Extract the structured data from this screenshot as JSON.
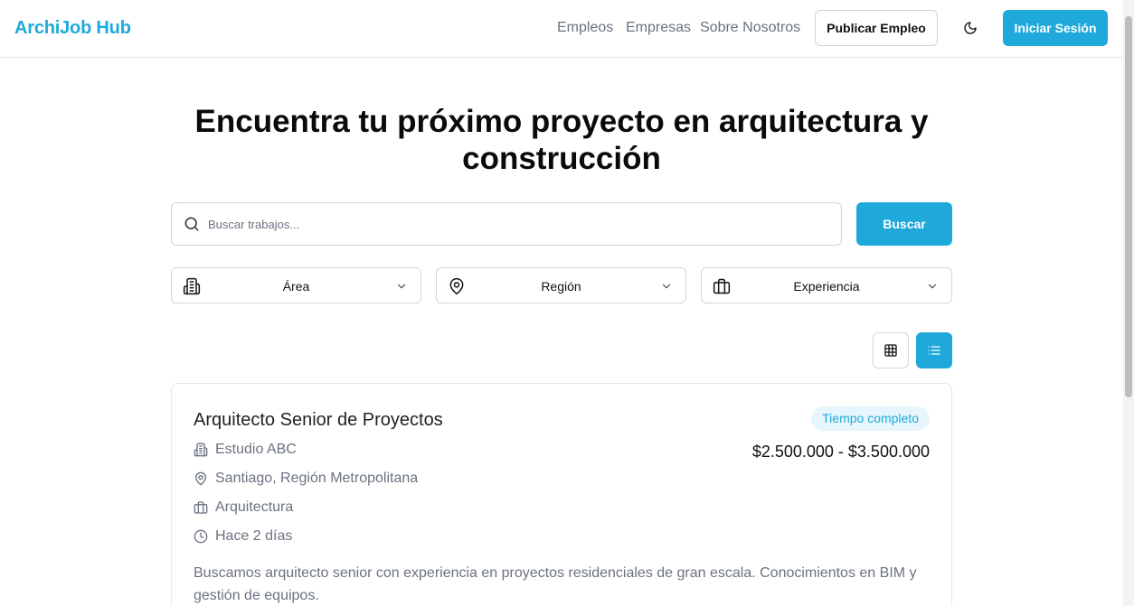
{
  "header": {
    "logo": "ArchiJob Hub",
    "nav": [
      "Empleos",
      "Empresas",
      "Sobre Nosotros"
    ],
    "publish_label": "Publicar Empleo",
    "login_label": "Iniciar Sesión"
  },
  "hero": {
    "title_line1": "Encuentra tu próximo proyecto en arquitectura y",
    "title_line2": "construcción"
  },
  "search": {
    "placeholder": "Buscar trabajos...",
    "button_label": "Buscar"
  },
  "filters": [
    {
      "label": "Área",
      "icon": "building-icon"
    },
    {
      "label": "Región",
      "icon": "map-pin-icon"
    },
    {
      "label": "Experiencia",
      "icon": "briefcase-icon"
    }
  ],
  "view_toggle": {
    "active": "list"
  },
  "colors": {
    "accent": "#1fa9db",
    "badge_bg": "#e6f6fc",
    "muted_text": "#6b7280"
  },
  "jobs": [
    {
      "title": "Arquitecto Senior de Proyectos",
      "badge": "Tiempo completo",
      "salary": "$2.500.000 - $3.500.000",
      "company": "Estudio ABC",
      "location": "Santiago, Región Metropolitana",
      "area": "Arquitectura",
      "posted": "Hace 2 días",
      "description_line1": "Buscamos arquitecto senior con experiencia en proyectos residenciales de gran escala. Conocimientos en BIM y",
      "description_line2": "gestión de equipos."
    }
  ]
}
